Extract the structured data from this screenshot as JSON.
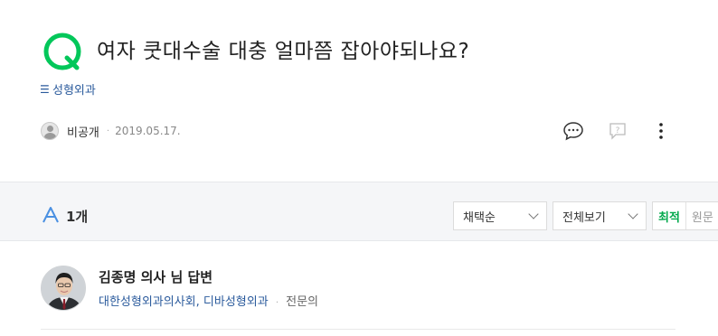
{
  "question": {
    "title": "여자 쿳대수술 대충 얼마쯤 잡아야되나요?",
    "category": "성형외과",
    "category_icon": "list-icon",
    "author": "비공개",
    "date": "2019.05.17."
  },
  "actions": {
    "comment_icon": "speech-bubble-icon",
    "report_icon": "question-report-icon",
    "more_icon": "more-vertical-icon"
  },
  "answers_bar": {
    "count_label": "1개",
    "sort_select": "채택순",
    "view_select": "전체보기",
    "toggle_latest": "최적",
    "toggle_original": "원문"
  },
  "answer": {
    "doctor_name": "김종명 의사 님 답변",
    "affiliation": "대한성형외과의사회, 디바성형외과",
    "role": "전문의"
  },
  "colors": {
    "brand_green": "#03c75a",
    "link_blue": "#2a5a9c",
    "answer_blue": "#4a90e2"
  }
}
